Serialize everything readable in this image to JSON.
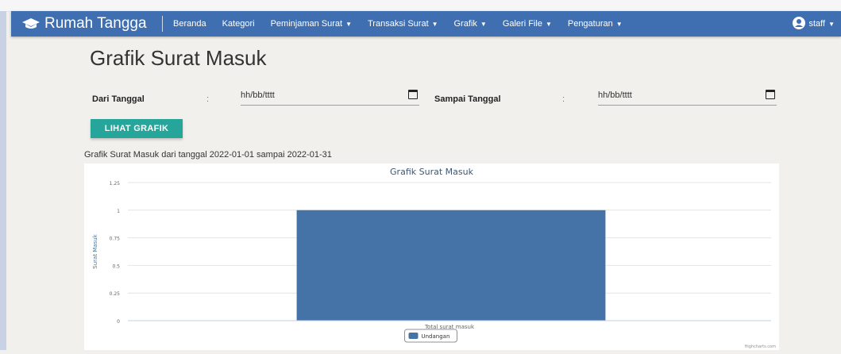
{
  "navbar": {
    "brand": "Rumah Tangga",
    "items": [
      {
        "label": "Beranda",
        "dropdown": false
      },
      {
        "label": "Kategori",
        "dropdown": false
      },
      {
        "label": "Peminjaman Surat",
        "dropdown": true
      },
      {
        "label": "Transaksi Surat",
        "dropdown": true
      },
      {
        "label": "Grafik",
        "dropdown": true
      },
      {
        "label": "Galeri File",
        "dropdown": true
      },
      {
        "label": "Pengaturan",
        "dropdown": true
      }
    ],
    "user": "staff",
    "caret": "▼",
    "color": "#3f6fb0"
  },
  "page": {
    "title": "Grafik Surat Masuk"
  },
  "form": {
    "from_label": "Dari Tanggal",
    "to_label": "Sampai Tanggal",
    "colon": ":",
    "from_value": "hh/bb/tttt",
    "to_value": "hh/bb/tttt",
    "button_label": "LIHAT GRAFIK",
    "button_color": "#26a69a"
  },
  "caption": "Grafik Surat Masuk dari tanggal 2022-01-01 sampai 2022-01-31",
  "chart_data": {
    "type": "bar",
    "title": "Grafik Surat Masuk",
    "ylabel": "Surat Masuk",
    "xlabel": "",
    "categories": [
      "Total surat masuk"
    ],
    "series": [
      {
        "name": "Undangan",
        "values": [
          1
        ],
        "color": "#4572a7"
      }
    ],
    "ylim": [
      0,
      1.25
    ],
    "yticks": [
      "0",
      "0.25",
      "0.5",
      "0.75",
      "1",
      "1.25"
    ],
    "grid": true,
    "legend": "bottom-center",
    "credits": "Highcharts.com"
  }
}
